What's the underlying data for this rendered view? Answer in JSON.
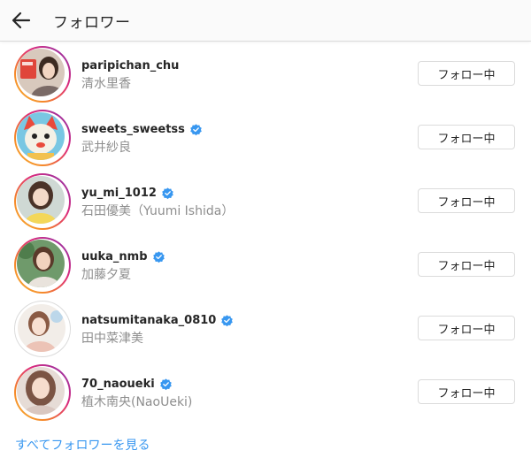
{
  "header": {
    "title": "フォロワー",
    "back_icon": "arrow-left-icon"
  },
  "colors": {
    "link": "#3897f0",
    "verified": "#3897f0",
    "secondary_text": "#8e8e8e",
    "story_ring": [
      "#f7b733",
      "#dd2a7b",
      "#8134af"
    ]
  },
  "followers": [
    {
      "username": "paripichan_chu",
      "display_name": "清水里香",
      "verified": false,
      "story_ring": true,
      "button_label": "フォロー中"
    },
    {
      "username": "sweets_sweetss",
      "display_name": "武井紗良",
      "verified": true,
      "story_ring": true,
      "button_label": "フォロー中"
    },
    {
      "username": "yu_mi_1012",
      "display_name": "石田優美（Yuumi Ishida）",
      "verified": true,
      "story_ring": true,
      "button_label": "フォロー中"
    },
    {
      "username": "uuka_nmb",
      "display_name": "加藤夕夏",
      "verified": true,
      "story_ring": true,
      "button_label": "フォロー中"
    },
    {
      "username": "natsumitanaka_0810",
      "display_name": "田中菜津美",
      "verified": true,
      "story_ring": false,
      "button_label": "フォロー中"
    },
    {
      "username": "70_naoueki",
      "display_name": "植木南央(NaoUeki)",
      "verified": true,
      "story_ring": true,
      "button_label": "フォロー中"
    }
  ],
  "footer": {
    "see_all_label": "すべてフォロワーを見る"
  }
}
